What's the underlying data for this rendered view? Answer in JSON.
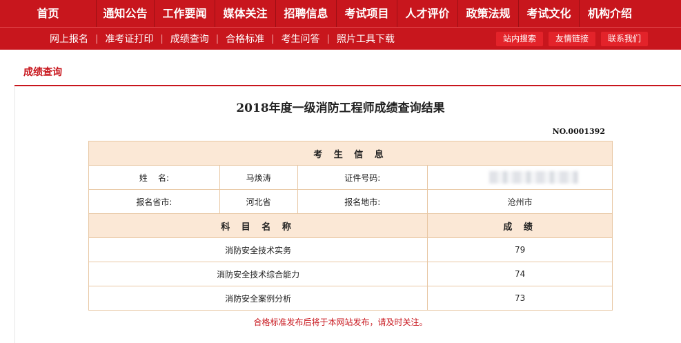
{
  "top_nav": [
    "首页",
    "通知公告",
    "工作要闻",
    "媒体关注",
    "招聘信息",
    "考试项目",
    "人才评价",
    "政策法规",
    "考试文化",
    "机构介绍"
  ],
  "sub_nav": [
    "网上报名",
    "准考证打印",
    "成绩查询",
    "合格标准",
    "考生问答",
    "照片工具下载"
  ],
  "sub_buttons": [
    "站内搜索",
    "友情链接",
    "联系我们"
  ],
  "breadcrumb": "成绩查询",
  "result": {
    "title": "2018年度一级消防工程师成绩查询结果",
    "serial": "NO.0001392",
    "section_candidate": "考 生 信 息",
    "name_label": "姓    名:",
    "name_value": "马焕涛",
    "id_label": "证件号码:",
    "id_value": "",
    "province_label": "报名省市:",
    "province_value": "河北省",
    "city_label": "报名地市:",
    "city_value": "沧州市",
    "subject_header": "科 目 名 称",
    "score_header": "成  绩",
    "subjects": [
      {
        "name": "消防安全技术实务",
        "score": "79"
      },
      {
        "name": "消防安全技术综合能力",
        "score": "74"
      },
      {
        "name": "消防安全案例分析",
        "score": "73"
      }
    ]
  },
  "notice": "合格标准发布后将于本网站发布，请及时关注。"
}
